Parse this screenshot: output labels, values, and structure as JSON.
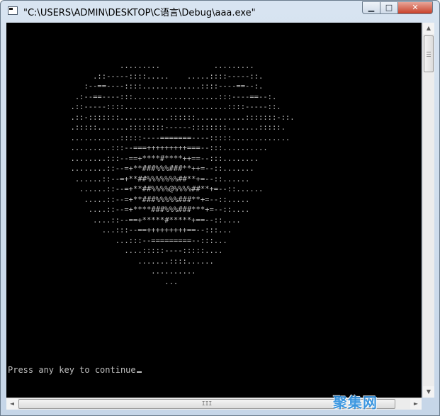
{
  "window": {
    "title": "\"C:\\USERS\\ADMIN\\DESKTOP\\C语言\\Debug\\aaa.exe\"",
    "controls": {
      "minimize_glyph": "▁",
      "maximize_glyph": "□",
      "close_glyph": "✕"
    }
  },
  "console": {
    "heart_lines": [
      "                         .........            .........",
      "                   .::-----::::.....    .....::::-----::.",
      "                 :--==----::::.............::::----==--:.",
      "               .:--==----:::...................:::----==--:.",
      "              .::-----::::.......................::::-----::.",
      "              .::-:::::::...........::::::...........:::::::-::.",
      "              .:::::.......::::::::------::::::::.......:::::.",
      "              ...........:::::----=======----:::::.............",
      "              .........:::--===+++++++++===--:::..........",
      "              ........:::--==+****#****++==--:::........",
      "              ........::--=+**###%%%###**++=--::.......",
      "               ......::--=+**##%%%%%%%##**+=--::......",
      "                ......::--=+**##%%%%@%%%%##**+=--::......",
      "                 .....::--=+**###%%%%%###**+=--::.....",
      "                  ....::--=+****###%%%###***+=--::....",
      "                   ....::--==+*****#*****+==--::....",
      "                     ...:::--==+++++++++==--:::...",
      "                        ...:::--=========--:::...",
      "                          ....:::::----:::::....",
      "                             .......::::......",
      "                                ..........",
      "                                   ..."
    ],
    "prompt": "Press any key to continue"
  },
  "scrollbars": {
    "up_glyph": "▲",
    "down_glyph": "▼",
    "left_glyph": "◄",
    "right_glyph": "►",
    "thumb_grip": "III"
  },
  "watermark": {
    "text": "聚集网",
    "color": "#2b8fe0"
  },
  "colors": {
    "console_bg": "#000000",
    "console_fg": "#c0c0c0",
    "close_button": "#c8412a"
  }
}
